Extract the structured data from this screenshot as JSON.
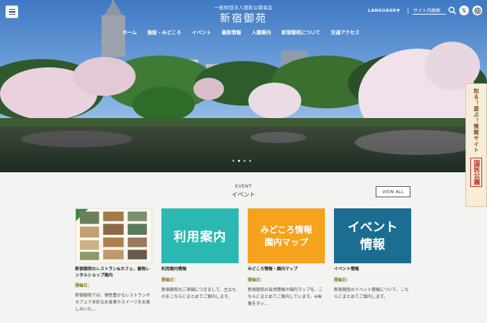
{
  "header": {
    "org_name": "一般財団法人国民公園協会",
    "site_title": "新宿御苑",
    "language_label": "LANGUAGE",
    "language_caret": "▼",
    "search_placeholder": "サイト内検索",
    "nav": [
      "ホーム",
      "施設・みどころ",
      "イベント",
      "最新情報",
      "入園案内",
      "新宿御苑について",
      "交通アクセス"
    ],
    "social_icons": [
      "x-icon",
      "instagram-icon",
      "facebook-icon"
    ]
  },
  "hero": {
    "slide_count": 4,
    "active_slide": 1
  },
  "side_banner": {
    "text": "知る！遊ぶ！情報サイト",
    "seal": "国民公園"
  },
  "events": {
    "title_en": "EVENT",
    "title_jp": "イベント",
    "view_all": "VIEW ALL",
    "cards": [
      {
        "thumb_text": "",
        "title": "新宿御苑のレストラン&カフェ、着物レンタルショップ案内",
        "date": "開催日：",
        "desc": "新宿御苑では、個性豊かなレストランやカフェで多彩なお食事やスイーツをお楽しみいた..."
      },
      {
        "thumb_text": "利用案内",
        "title": "利用案内情報",
        "date": "開催日：",
        "desc": "新宿御苑のご来園につきまして、主なものをこちらにまとめてご案内します。"
      },
      {
        "thumb_text": "みどころ情報\n園内マップ",
        "title": "みどころ情報・園内マップ",
        "date": "開催日：",
        "desc": "新宿御苑の自然情報や園内マップを、こちらにまとめてご案内しています。※画像をタッ..."
      },
      {
        "thumb_text": "イベント\n情報",
        "title": "イベント情報",
        "date": "開催日：",
        "desc": "新宿御苑のイベント情報について、こちらにまとめてご案内します。"
      }
    ]
  },
  "colors": {
    "teal": "#2cb8b2",
    "orange": "#f5a21d",
    "blue": "#1b6e91",
    "date_gold": "#8a7a1e"
  }
}
